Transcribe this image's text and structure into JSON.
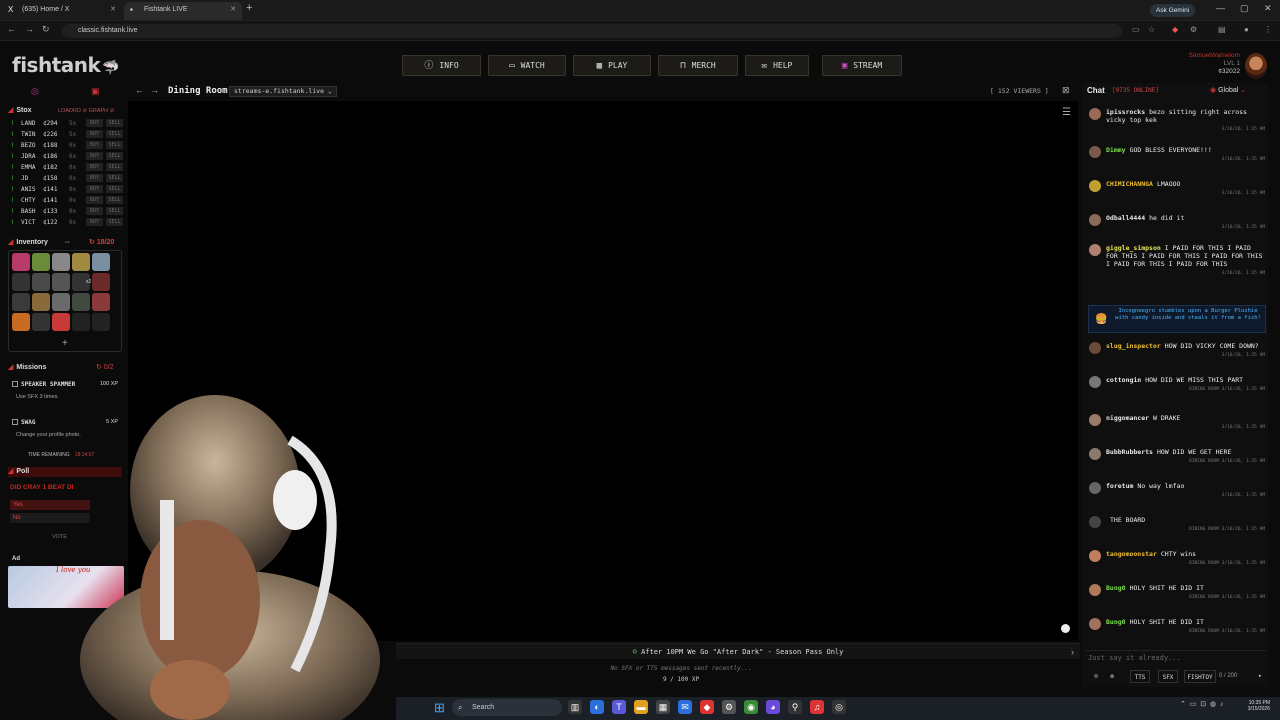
{
  "browser": {
    "tabs": [
      {
        "icon": "X",
        "label": "(635) Home / X"
      },
      {
        "icon": "fishtank-icon",
        "label": "Fishtank LIVE"
      }
    ],
    "ask_gemini": "Ask Gemini",
    "url": "classic.fishtank.live"
  },
  "site": {
    "logo": "fishtank",
    "nav": [
      {
        "icon": "info-icon",
        "label": "INFO"
      },
      {
        "icon": "tv-icon",
        "label": "WATCH"
      },
      {
        "icon": "grid-icon",
        "label": "PLAY"
      },
      {
        "icon": "shirt-icon",
        "label": "MERCH"
      },
      {
        "icon": "help-icon",
        "label": "HELP"
      },
      {
        "icon": "stream-icon",
        "label": "STREAM"
      }
    ],
    "user": {
      "name": "SamuelWarnelom",
      "level": "LVL 1",
      "coins": "¢32022"
    }
  },
  "stox": {
    "title": "Stox",
    "options": "LOADRD ⊘ GRAPH ⊘",
    "rows": [
      {
        "ticker": "LAND",
        "price": "¢294",
        "qty": "5x",
        "buy": "BUY",
        "sell": "SELL"
      },
      {
        "ticker": "TWIN",
        "price": "¢226",
        "qty": "5x",
        "buy": "BUY",
        "sell": "SELL"
      },
      {
        "ticker": "BEZO",
        "price": "¢188",
        "qty": "0x",
        "buy": "BUY",
        "sell": "SELL"
      },
      {
        "ticker": "JDRA",
        "price": "¢186",
        "qty": "6x",
        "buy": "BUY",
        "sell": "SELL"
      },
      {
        "ticker": "EMMA",
        "price": "¢182",
        "qty": "0x",
        "buy": "BUY",
        "sell": "SELL"
      },
      {
        "ticker": "JD",
        "price": "¢158",
        "qty": "0x",
        "buy": "BUY",
        "sell": "SELL"
      },
      {
        "ticker": "ANIS",
        "price": "¢141",
        "qty": "0x",
        "buy": "BUY",
        "sell": "SELL"
      },
      {
        "ticker": "CHTY",
        "price": "¢141",
        "qty": "0x",
        "buy": "BUY",
        "sell": "SELL"
      },
      {
        "ticker": "BASH",
        "price": "¢133",
        "qty": "0x",
        "buy": "BUY",
        "sell": "SELL"
      },
      {
        "ticker": "VICT",
        "price": "¢122",
        "qty": "0x",
        "buy": "BUY",
        "sell": "SELL"
      }
    ]
  },
  "inventory": {
    "title": "Inventory",
    "count": "18/20",
    "stack_label": "x2",
    "add": "+",
    "item_colors": [
      "#b83a6a",
      "#6b8a3a",
      "#888",
      "#a08a40",
      "#7a8fa0",
      "#333",
      "#4a4a4a",
      "#555",
      "#333",
      "#6a2a2a",
      "#3a3a3a",
      "#8a6a3a",
      "#6a6a6a",
      "#404a40",
      "#8a3a3a",
      "#c86a20",
      "#333",
      "#c83a3a",
      "#222",
      "#222"
    ]
  },
  "missions": {
    "title": "Missions",
    "count": "0/2",
    "items": [
      {
        "title": "SPEAKER SPAMMER",
        "xp": "100 XP",
        "desc": "Use SFX 3 times."
      },
      {
        "title": "SWAG",
        "xp": "5 XP",
        "desc": "Change your profile photo."
      }
    ],
    "time_label": "TIME REMAINING",
    "time_value": "18:14:07"
  },
  "poll": {
    "title": "Poll",
    "question": "DID CRAY 1 BEAT DI",
    "options": [
      "Yes",
      "No"
    ],
    "vote": "VOTE"
  },
  "ad": {
    "label": "Ad",
    "text": "I love you"
  },
  "stream": {
    "room": "Dining Room",
    "source": "streams-e.fishtank.live",
    "viewers": "[ 152 VIEWERS ]",
    "banner": "After 10PM We Go \"After Dark\" - Season Pass Only",
    "no_sfx": "No SFX or TTS messages sent recently...",
    "xp": "9 / 100 XP"
  },
  "chat": {
    "title": "Chat",
    "online": "[9735 ONLINE]",
    "channel": "Global",
    "messages": [
      {
        "user": "ipissrocks",
        "color": "#e8e8e8",
        "text": "bezo sitting right across vicky top kek",
        "meta": "3/16/26, 1:35 AM"
      },
      {
        "user": "Dimmy",
        "color": "#7be050",
        "text": "GOD BLESS EVERYONE!!!",
        "meta": "3/16/26, 1:35 AM"
      },
      {
        "user": "CHIMICHANNGA",
        "color": "#f0c030",
        "text": "LMAOOO",
        "meta": "3/16/26, 1:35 AM"
      },
      {
        "user": "Odball4444",
        "color": "#e8e8e8",
        "text": "he did it",
        "meta": "3/16/26, 1:35 AM"
      },
      {
        "user": "giggle_simpson",
        "color": "#e8e85a",
        "text": "I PAID FOR THIS I PAID FOR THIS I PAID FOR THIS I PAID FOR THIS I PAID FOR THIS I PAID FOR THIS",
        "meta": "3/16/26, 1:35 AM"
      },
      {
        "user": "slug_inspector",
        "color": "#f0c030",
        "text": "HOW DID VICKY COME DOWN?",
        "meta": "3/16/26, 1:35 AM"
      },
      {
        "user": "cottongin",
        "color": "#e8e8e8",
        "text": "HOW DID WE MISS THIS PART",
        "meta": "DINING ROOM  3/16/26, 1:35 AM"
      },
      {
        "user": "niggomancer",
        "color": "#e8e8e8",
        "text": "W DRAKE",
        "meta": "3/16/26, 1:35 AM"
      },
      {
        "user": "BubbRubberts",
        "color": "#e8e8e8",
        "text": "HOW DID WE GET HERE",
        "meta": "DINING ROOM  3/16/26, 1:35 AM"
      },
      {
        "user": "foretum",
        "color": "#e8e8e8",
        "text": "No way lmfao",
        "meta": "3/16/26, 1:35 AM"
      },
      {
        "user": "",
        "color": "#e05050",
        "text": "THE BOARD",
        "meta": "DINING ROOM  3/16/26, 1:35 AM"
      },
      {
        "user": "tangomoonstar",
        "color": "#f0c030",
        "text": "CHTY wins",
        "meta": "DINING ROOM  3/16/26, 1:35 AM"
      },
      {
        "user": "Bung0",
        "color": "#7be050",
        "text": "HOLY SHIT HE DID IT",
        "meta": "DINING ROOM  3/16/26, 1:35 AM"
      },
      {
        "user": "Bung0",
        "color": "#7be050",
        "text": "HOLY SHIT HE DID IT",
        "meta": "DINING ROOM  3/16/26, 1:35 AM"
      }
    ],
    "system_message": "Incogneegro stumbles upon a Burger Plushie with candy inside and steals it from a fish!",
    "input_placeholder": "Just say it already...",
    "buttons": [
      "TTS",
      "SFX",
      "FISHTOY"
    ],
    "counter": "0 / 200"
  },
  "taskbar": {
    "search": "Search",
    "clock_time": "10:35 PM",
    "clock_date": "3/15/2026"
  }
}
